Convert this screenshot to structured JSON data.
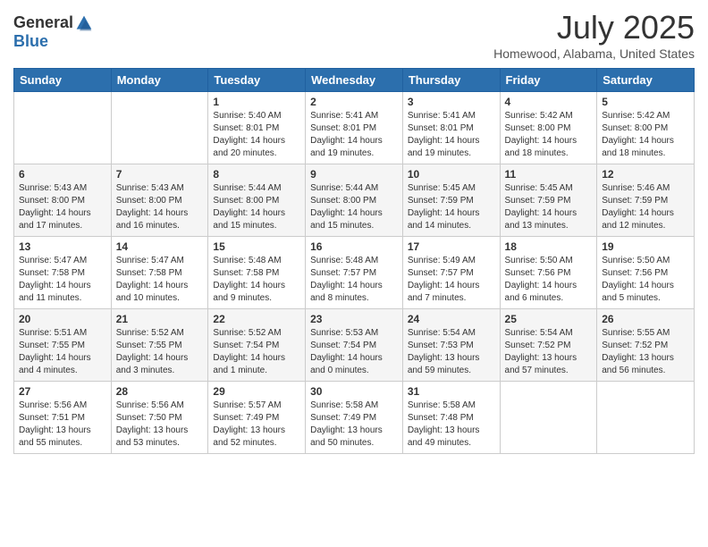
{
  "header": {
    "logo_general": "General",
    "logo_blue": "Blue",
    "title": "July 2025",
    "location": "Homewood, Alabama, United States"
  },
  "days_of_week": [
    "Sunday",
    "Monday",
    "Tuesday",
    "Wednesday",
    "Thursday",
    "Friday",
    "Saturday"
  ],
  "weeks": [
    [
      {
        "day": "",
        "info": ""
      },
      {
        "day": "",
        "info": ""
      },
      {
        "day": "1",
        "info": "Sunrise: 5:40 AM\nSunset: 8:01 PM\nDaylight: 14 hours and 20 minutes."
      },
      {
        "day": "2",
        "info": "Sunrise: 5:41 AM\nSunset: 8:01 PM\nDaylight: 14 hours and 19 minutes."
      },
      {
        "day": "3",
        "info": "Sunrise: 5:41 AM\nSunset: 8:01 PM\nDaylight: 14 hours and 19 minutes."
      },
      {
        "day": "4",
        "info": "Sunrise: 5:42 AM\nSunset: 8:00 PM\nDaylight: 14 hours and 18 minutes."
      },
      {
        "day": "5",
        "info": "Sunrise: 5:42 AM\nSunset: 8:00 PM\nDaylight: 14 hours and 18 minutes."
      }
    ],
    [
      {
        "day": "6",
        "info": "Sunrise: 5:43 AM\nSunset: 8:00 PM\nDaylight: 14 hours and 17 minutes."
      },
      {
        "day": "7",
        "info": "Sunrise: 5:43 AM\nSunset: 8:00 PM\nDaylight: 14 hours and 16 minutes."
      },
      {
        "day": "8",
        "info": "Sunrise: 5:44 AM\nSunset: 8:00 PM\nDaylight: 14 hours and 15 minutes."
      },
      {
        "day": "9",
        "info": "Sunrise: 5:44 AM\nSunset: 8:00 PM\nDaylight: 14 hours and 15 minutes."
      },
      {
        "day": "10",
        "info": "Sunrise: 5:45 AM\nSunset: 7:59 PM\nDaylight: 14 hours and 14 minutes."
      },
      {
        "day": "11",
        "info": "Sunrise: 5:45 AM\nSunset: 7:59 PM\nDaylight: 14 hours and 13 minutes."
      },
      {
        "day": "12",
        "info": "Sunrise: 5:46 AM\nSunset: 7:59 PM\nDaylight: 14 hours and 12 minutes."
      }
    ],
    [
      {
        "day": "13",
        "info": "Sunrise: 5:47 AM\nSunset: 7:58 PM\nDaylight: 14 hours and 11 minutes."
      },
      {
        "day": "14",
        "info": "Sunrise: 5:47 AM\nSunset: 7:58 PM\nDaylight: 14 hours and 10 minutes."
      },
      {
        "day": "15",
        "info": "Sunrise: 5:48 AM\nSunset: 7:58 PM\nDaylight: 14 hours and 9 minutes."
      },
      {
        "day": "16",
        "info": "Sunrise: 5:48 AM\nSunset: 7:57 PM\nDaylight: 14 hours and 8 minutes."
      },
      {
        "day": "17",
        "info": "Sunrise: 5:49 AM\nSunset: 7:57 PM\nDaylight: 14 hours and 7 minutes."
      },
      {
        "day": "18",
        "info": "Sunrise: 5:50 AM\nSunset: 7:56 PM\nDaylight: 14 hours and 6 minutes."
      },
      {
        "day": "19",
        "info": "Sunrise: 5:50 AM\nSunset: 7:56 PM\nDaylight: 14 hours and 5 minutes."
      }
    ],
    [
      {
        "day": "20",
        "info": "Sunrise: 5:51 AM\nSunset: 7:55 PM\nDaylight: 14 hours and 4 minutes."
      },
      {
        "day": "21",
        "info": "Sunrise: 5:52 AM\nSunset: 7:55 PM\nDaylight: 14 hours and 3 minutes."
      },
      {
        "day": "22",
        "info": "Sunrise: 5:52 AM\nSunset: 7:54 PM\nDaylight: 14 hours and 1 minute."
      },
      {
        "day": "23",
        "info": "Sunrise: 5:53 AM\nSunset: 7:54 PM\nDaylight: 14 hours and 0 minutes."
      },
      {
        "day": "24",
        "info": "Sunrise: 5:54 AM\nSunset: 7:53 PM\nDaylight: 13 hours and 59 minutes."
      },
      {
        "day": "25",
        "info": "Sunrise: 5:54 AM\nSunset: 7:52 PM\nDaylight: 13 hours and 57 minutes."
      },
      {
        "day": "26",
        "info": "Sunrise: 5:55 AM\nSunset: 7:52 PM\nDaylight: 13 hours and 56 minutes."
      }
    ],
    [
      {
        "day": "27",
        "info": "Sunrise: 5:56 AM\nSunset: 7:51 PM\nDaylight: 13 hours and 55 minutes."
      },
      {
        "day": "28",
        "info": "Sunrise: 5:56 AM\nSunset: 7:50 PM\nDaylight: 13 hours and 53 minutes."
      },
      {
        "day": "29",
        "info": "Sunrise: 5:57 AM\nSunset: 7:49 PM\nDaylight: 13 hours and 52 minutes."
      },
      {
        "day": "30",
        "info": "Sunrise: 5:58 AM\nSunset: 7:49 PM\nDaylight: 13 hours and 50 minutes."
      },
      {
        "day": "31",
        "info": "Sunrise: 5:58 AM\nSunset: 7:48 PM\nDaylight: 13 hours and 49 minutes."
      },
      {
        "day": "",
        "info": ""
      },
      {
        "day": "",
        "info": ""
      }
    ]
  ]
}
